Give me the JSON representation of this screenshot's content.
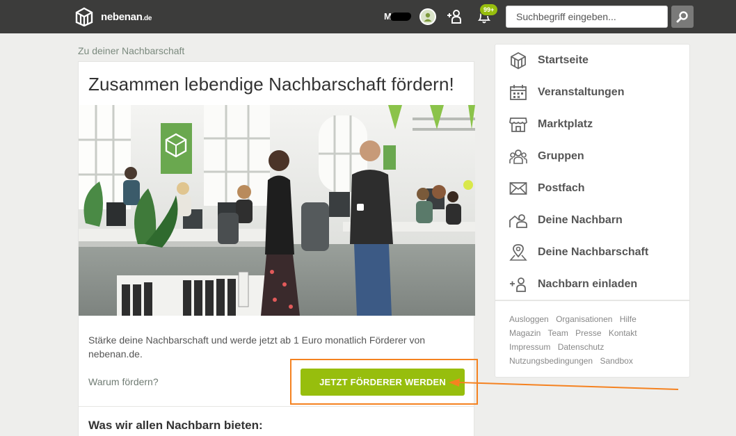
{
  "header": {
    "logo_text": "nebenan",
    "logo_suffix": ".de",
    "user_name": "M",
    "notification_count": "99+",
    "search_placeholder": "Suchbegriff eingeben..."
  },
  "breadcrumb": "Zu deiner Nachbarschaft",
  "main": {
    "title": "Zusammen lebendige Nachbarschaft fördern!",
    "body": "Stärke deine Nachbarschaft und werde jetzt ab 1 Euro monatlich Förderer von nebenan.de.",
    "why_link": "Warum fördern?",
    "cta_label": "JETZT FÖRDERER WERDEN",
    "section_title": "Was wir allen Nachbarn bieten:"
  },
  "sidebar": {
    "items": [
      {
        "label": "Startseite",
        "icon": "house-icon"
      },
      {
        "label": "Veranstaltungen",
        "icon": "calendar-icon"
      },
      {
        "label": "Marktplatz",
        "icon": "shop-icon"
      },
      {
        "label": "Gruppen",
        "icon": "group-icon"
      },
      {
        "label": "Postfach",
        "icon": "envelope-icon"
      },
      {
        "label": "Deine Nachbarn",
        "icon": "neighbors-icon"
      },
      {
        "label": "Deine Nachbarschaft",
        "icon": "map-pin-icon"
      },
      {
        "label": "Nachbarn einladen",
        "icon": "invite-user-icon"
      }
    ],
    "footer_links": [
      "Ausloggen",
      "Organisationen",
      "Hilfe",
      "Magazin",
      "Team",
      "Presse",
      "Kontakt",
      "Impressum",
      "Datenschutz",
      "Nutzungsbedingungen",
      "Sandbox"
    ]
  },
  "colors": {
    "topbar": "#3c3c3b",
    "accent_green": "#97be0d",
    "annotation_orange": "#f58220"
  }
}
